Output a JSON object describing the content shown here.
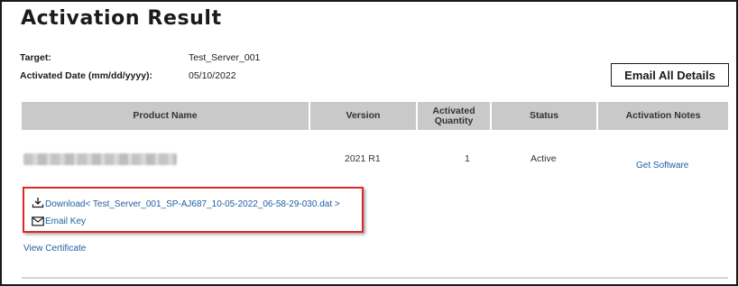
{
  "page": {
    "title": "Activation Result"
  },
  "meta": {
    "target_label": "Target:",
    "target_value": "Test_Server_001",
    "date_label": "Activated Date (mm/dd/yyyy):",
    "date_value": "05/10/2022"
  },
  "actions": {
    "email_all_label": "Email All Details"
  },
  "table": {
    "columns": [
      "Product Name",
      "Version",
      "Activated Quantity",
      "Status",
      "Activation Notes"
    ],
    "rows": [
      {
        "product_name": "",
        "version": "2021 R1",
        "quantity": "1",
        "status": "Active",
        "notes_link": "Get Software"
      }
    ]
  },
  "downloads": {
    "download_label": "Download< Test_Server_001_SP-AJ687_10-05-2022_06-58-29-030.dat >",
    "email_key_label": "Email Key",
    "view_certificate_label": "View Certificate"
  },
  "colors": {
    "header_bg": "#c9c9c9",
    "link": "#1f5fa3",
    "highlight_border": "#e0262b"
  }
}
